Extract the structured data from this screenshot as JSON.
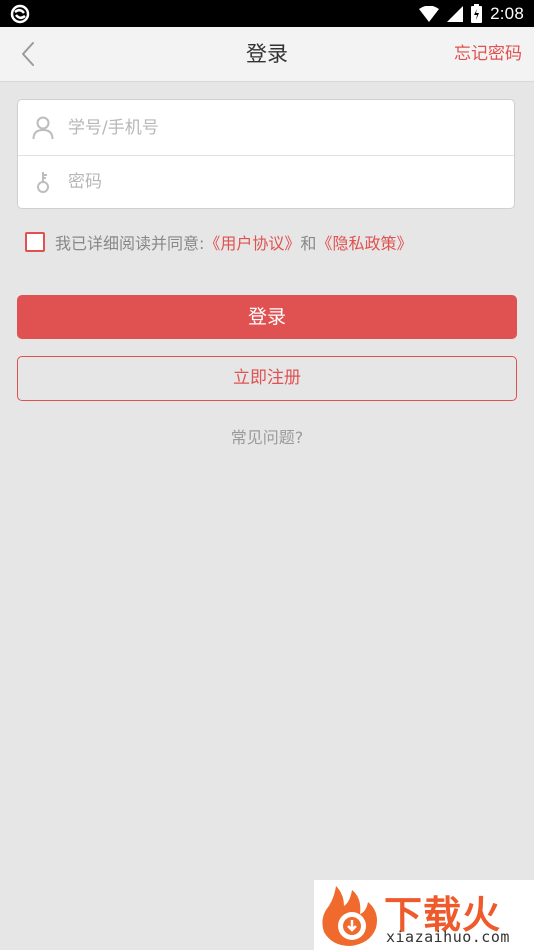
{
  "status_bar": {
    "time": "2:08"
  },
  "header": {
    "title": "登录",
    "forgot_label": "忘记密码"
  },
  "form": {
    "username_placeholder": "学号/手机号",
    "password_placeholder": "密码"
  },
  "agreement": {
    "prefix": "我已详细阅读并同意:",
    "user_agreement": "《用户协议》",
    "and": "和",
    "privacy_policy": "《隐私政策》"
  },
  "buttons": {
    "login": "登录",
    "register": "立即注册"
  },
  "faq_label": "常见问题?",
  "watermark": {
    "brand": "下载火",
    "url": "xiazaihuo.com"
  },
  "colors": {
    "accent": "#e05252",
    "background": "#e6e6e6"
  }
}
